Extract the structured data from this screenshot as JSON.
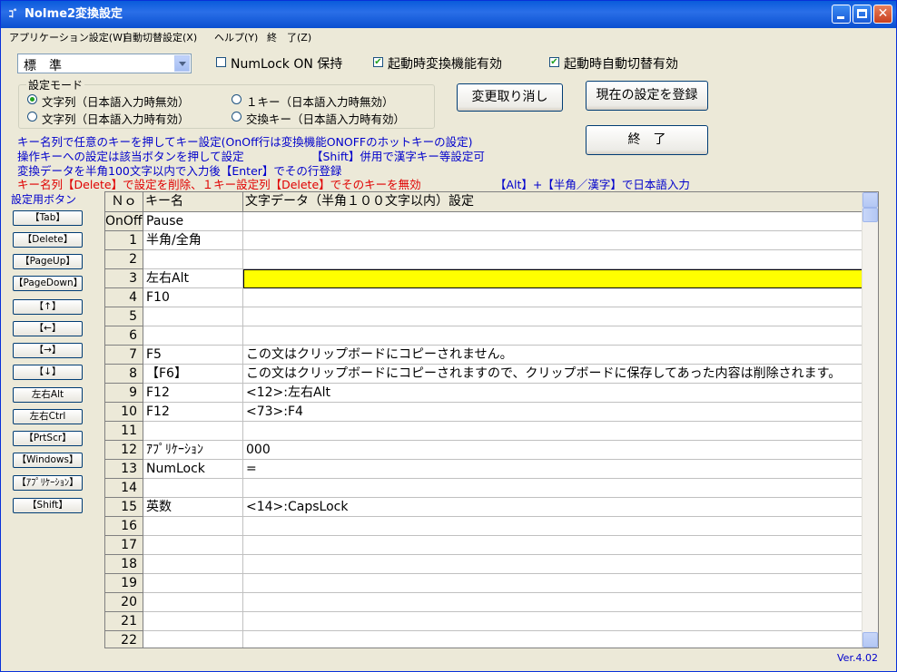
{
  "window": {
    "title": "NoIme2変換設定",
    "icon": "app-icon",
    "title_icon_text": "ｺﾞ"
  },
  "menu": [
    "アプリケーション設定(W)",
    "自動切替設定(X)",
    "ヘルプ(Y)",
    "終　了(Z)"
  ],
  "profile_combo": {
    "value": "標　準"
  },
  "checks": [
    {
      "label": "NumLock ON 保持",
      "checked": false
    },
    {
      "label": "起動時変換機能有効",
      "checked": true
    },
    {
      "label": "起動時自動切替有効",
      "checked": true
    }
  ],
  "mode_group": {
    "title": "設定モード",
    "options": [
      {
        "label": "文字列（日本語入力時無効）",
        "selected": true
      },
      {
        "label": "１キー（日本語入力時無効）",
        "selected": false
      },
      {
        "label": "文字列（日本語入力時有効）",
        "selected": false
      },
      {
        "label": "交換キー（日本語入力時有効）",
        "selected": false
      }
    ]
  },
  "buttons": {
    "undo": "変更取り消し",
    "register": "現在の設定を登録",
    "exit": "終　了"
  },
  "info_lines": [
    "キー名列で任意のキーを押してキー設定(OnOff行は変換機能ONOFFのホットキーの設定)",
    "操作キーへの設定は該当ボタンを押して設定",
    "【Shift】併用で漢字キー等設定可",
    "変換データを半角100文字以内で入力後【Enter】でその行登録",
    "キー名列【Delete】で設定を削除、１キー設定列【Delete】でそのキーを無効",
    "【Alt】+【半角／漢字】で日本語入力"
  ],
  "sidebar": {
    "title": "設定用ボタン",
    "buttons": [
      "【Tab】",
      "【Delete】",
      "【PageUp】",
      "【PageDown】",
      "【↑】",
      "【←】",
      "【→】",
      "【↓】",
      "左右Alt",
      "左右Ctrl",
      "【PrtScr】",
      "【Windows】",
      "【ｱﾌﾟﾘｹｰｼｮﾝ】",
      "【Shift】"
    ]
  },
  "grid": {
    "headers": {
      "no": "Ｎｏ",
      "key": "キー名",
      "text": "文字データ（半角１００文字以内）設定"
    },
    "rows": [
      {
        "no": "OnOff",
        "key": "Pause",
        "text": ""
      },
      {
        "no": "1",
        "key": "半角/全角",
        "text": ""
      },
      {
        "no": "2",
        "key": "",
        "text": ""
      },
      {
        "no": "3",
        "key": "左右Alt",
        "text": "",
        "highlight": true
      },
      {
        "no": "4",
        "key": "F10",
        "text": ""
      },
      {
        "no": "5",
        "key": "",
        "text": ""
      },
      {
        "no": "6",
        "key": "",
        "text": ""
      },
      {
        "no": "7",
        "key": "F5",
        "text": "この文はクリップボードにコピーされません。"
      },
      {
        "no": "8",
        "key": "【F6】",
        "text": "この文はクリップボードにコピーされますので、クリップボードに保存してあった内容は削除されます。"
      },
      {
        "no": "9",
        "key": "F12",
        "text": "<12>:左右Alt"
      },
      {
        "no": "10",
        "key": "F12",
        "text": "<73>:F4"
      },
      {
        "no": "11",
        "key": "",
        "text": ""
      },
      {
        "no": "12",
        "key": "ｱﾌﾟﾘｹｰｼｮﾝ",
        "text": "000"
      },
      {
        "no": "13",
        "key": "NumLock",
        "text": "="
      },
      {
        "no": "14",
        "key": "",
        "text": ""
      },
      {
        "no": "15",
        "key": "英数",
        "text": "<14>:CapsLock"
      },
      {
        "no": "16",
        "key": "",
        "text": ""
      },
      {
        "no": "17",
        "key": "",
        "text": ""
      },
      {
        "no": "18",
        "key": "",
        "text": ""
      },
      {
        "no": "19",
        "key": "",
        "text": ""
      },
      {
        "no": "20",
        "key": "",
        "text": ""
      },
      {
        "no": "21",
        "key": "",
        "text": ""
      },
      {
        "no": "22",
        "key": "",
        "text": ""
      }
    ]
  },
  "version": "Ver.4.02",
  "colors": {
    "title_blue": "#0A5BDB",
    "info_blue": "#0000CC",
    "info_red": "#E00000",
    "highlight": "#FFFF00"
  }
}
